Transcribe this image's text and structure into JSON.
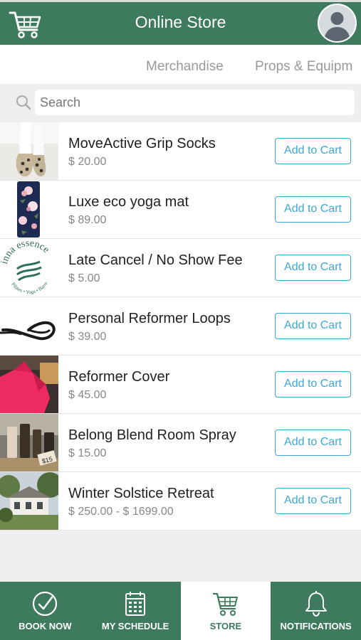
{
  "header": {
    "title": "Online Store",
    "cart_icon": "shopping-cart-icon",
    "avatar_icon": "user-avatar-icon"
  },
  "tabs": [
    {
      "label": "Merchandise"
    },
    {
      "label": "Props & Equipm"
    }
  ],
  "search": {
    "placeholder": "Search",
    "icon": "search-icon"
  },
  "products": [
    {
      "name": "MoveActive Grip Socks",
      "price": "$ 20.00",
      "button": "Add to Cart"
    },
    {
      "name": "Luxe eco yoga mat",
      "price": "$ 89.00",
      "button": "Add to Cart"
    },
    {
      "name": "Late Cancel / No Show Fee",
      "price": "$ 5.00",
      "button": "Add to Cart"
    },
    {
      "name": "Personal Reformer Loops",
      "price": "$ 39.00",
      "button": "Add to Cart"
    },
    {
      "name": "Reformer Cover",
      "price": "$ 45.00",
      "button": "Add to Cart"
    },
    {
      "name": "Belong Blend Room Spray",
      "price": "$ 15.00",
      "button": "Add to Cart"
    },
    {
      "name": "Winter Solstice Retreat",
      "price": "$ 250.00 - $ 1699.00",
      "button": "Add to Cart"
    }
  ],
  "logo_text": "inna essence",
  "logo_subtext": "Pilates • Yoga • Barre",
  "spray_label": "$15",
  "bottom_nav": [
    {
      "label": "BOOK NOW",
      "icon": "check-circle-icon"
    },
    {
      "label": "MY SCHEDULE",
      "icon": "calendar-icon"
    },
    {
      "label": "STORE",
      "icon": "shopping-cart-icon",
      "active": true
    },
    {
      "label": "NOTIFICATIONS",
      "icon": "bell-icon"
    }
  ],
  "colors": {
    "brand_green": "#3e7a5e",
    "accent_blue": "#3ea8d6",
    "background": "#efefef"
  }
}
